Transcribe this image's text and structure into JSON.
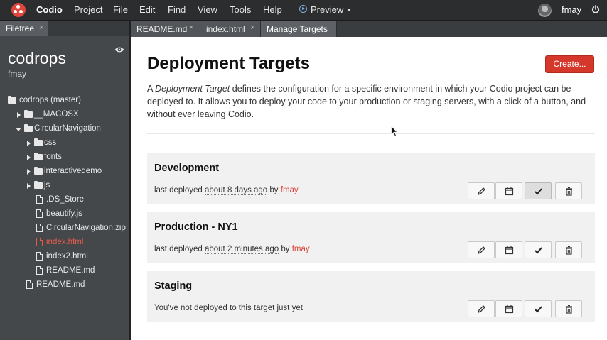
{
  "topbar": {
    "brand": "Codio",
    "menu": [
      "Project",
      "File",
      "Edit",
      "Find",
      "View",
      "Tools",
      "Help"
    ],
    "preview_label": "Preview",
    "user_name": "fmay"
  },
  "sidebar": {
    "tab_label": "Filetree",
    "tab_close": "×",
    "project_name": "codrops",
    "project_user": "fmay",
    "tree": [
      {
        "label": "codrops (master)",
        "kind": "root"
      },
      {
        "label": "__MACOSX",
        "kind": "folder-closed"
      },
      {
        "label": "CircularNavigation",
        "kind": "folder-open"
      },
      {
        "label": "css",
        "kind": "folder-closed"
      },
      {
        "label": "fonts",
        "kind": "folder-closed"
      },
      {
        "label": "interactivedemo",
        "kind": "folder-closed"
      },
      {
        "label": "js",
        "kind": "folder-closed"
      },
      {
        "label": ".DS_Store",
        "kind": "file"
      },
      {
        "label": "beautify.js",
        "kind": "file"
      },
      {
        "label": "CircularNavigation.zip",
        "kind": "file"
      },
      {
        "label": "index.html",
        "kind": "file",
        "active": true
      },
      {
        "label": "index2.html",
        "kind": "file"
      },
      {
        "label": "README.md",
        "kind": "file"
      },
      {
        "label": "README.md",
        "kind": "file"
      }
    ]
  },
  "editor_tabs": [
    {
      "label": "README.md",
      "close": "×"
    },
    {
      "label": "index.html",
      "close": "×"
    },
    {
      "label": "Manage Targets",
      "active": true
    }
  ],
  "page": {
    "title": "Deployment Targets",
    "create_label": "Create...",
    "intro_prefix": "A ",
    "intro_em": "Deployment Target",
    "intro_suffix": " defines the configuration for a specific environment in which your Codio project can be deployed to. It allows you to deploy your code to your production or staging servers, with a click of a button, and without ever leaving Codio."
  },
  "targets": [
    {
      "name": "Development",
      "status_prefix": "last deployed ",
      "status_time": "about 8 days ago",
      "status_by": " by ",
      "status_user": "fmay"
    },
    {
      "name": "Production - NY1",
      "status_prefix": "last deployed ",
      "status_time": "about 2 minutes ago",
      "status_by": " by ",
      "status_user": "fmay"
    },
    {
      "name": "Staging",
      "status_text": "You've not deployed to this target just yet"
    }
  ],
  "colors": {
    "accent": "#d5382a",
    "active_file": "#e45a4a",
    "topbar_bg": "#2b2d2f",
    "sidebar_bg": "#44484b"
  },
  "icons": [
    "codio-logo-icon",
    "play-circle-icon",
    "chevron-down-icon",
    "power-icon",
    "eye-icon",
    "folder-icon",
    "file-icon",
    "edit-icon",
    "calendar-icon",
    "check-icon",
    "trash-icon"
  ]
}
